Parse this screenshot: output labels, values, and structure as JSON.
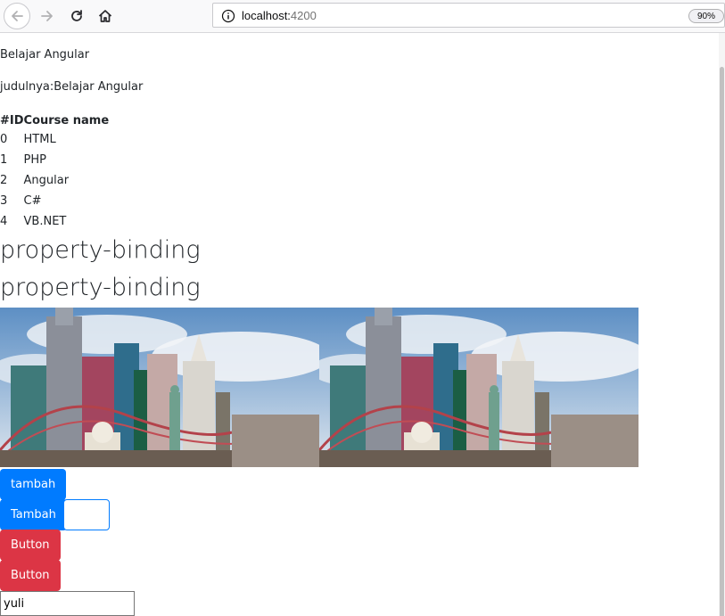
{
  "browser": {
    "url_host": "localhost:",
    "url_port": "4200",
    "zoom": "90%"
  },
  "page": {
    "heading": "Belajar Angular",
    "title_line": "judulnya:Belajar Angular",
    "table": {
      "headers": [
        "#ID",
        "Course name"
      ],
      "rows": [
        [
          "0",
          "HTML"
        ],
        [
          "1",
          "PHP"
        ],
        [
          "2",
          "Angular"
        ],
        [
          "3",
          "C#"
        ],
        [
          "4",
          "VB.NET"
        ]
      ]
    },
    "binding_title_1": "property-binding",
    "binding_title_2": "property-binding",
    "buttons": {
      "tambah_lower": "tambah",
      "tambah_upper": "Tambah",
      "button_1": "Button",
      "button_2": "Button"
    },
    "name_input_value": "yuli"
  },
  "colors": {
    "primary": "#007bff",
    "danger": "#dc3545"
  }
}
